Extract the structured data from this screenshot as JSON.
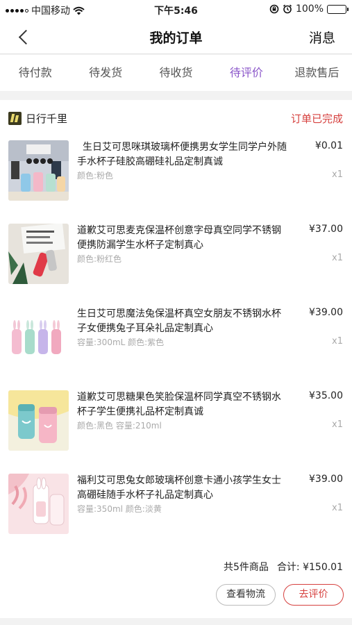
{
  "status_bar": {
    "carrier": "中国移动",
    "time": "下午5:46",
    "battery": "100%"
  },
  "nav": {
    "title": "我的订单",
    "right_label": "消息"
  },
  "tabs": [
    {
      "label": "待付款",
      "active": false
    },
    {
      "label": "待发货",
      "active": false
    },
    {
      "label": "待收货",
      "active": false
    },
    {
      "label": "待评价",
      "active": true
    },
    {
      "label": "退款售后",
      "active": false
    }
  ],
  "order": {
    "shop_name": "日行千里",
    "status": "订单已完成",
    "items": [
      {
        "title": "生日艾可思咪琪玻璃杯便携男女学生同学户外随手水杯子硅胶高硼硅礼品定制真诚",
        "spec": "颜色:粉色",
        "price": "¥0.01",
        "qty": "x1"
      },
      {
        "title": "道歉艾可思麦克保温杯创意字母真空同学不锈钢便携防漏学生水杯子定制真心",
        "spec": "颜色:粉红色",
        "price": "¥37.00",
        "qty": "x1"
      },
      {
        "title": "生日艾可思魔法兔保温杯真空女朋友不锈钢水杯子女便携兔子耳朵礼品定制真心",
        "spec": "容量:300mL 颜色:紫色",
        "price": "¥39.00",
        "qty": "x1"
      },
      {
        "title": "道歉艾可思糖果色笑脸保温杯同学真空不锈钢水杯子学生便携礼品杯定制真诚",
        "spec": "颜色:黑色 容量:210ml",
        "price": "¥35.00",
        "qty": "x1"
      },
      {
        "title": "福利艾可思兔女郎玻璃杯创意卡通小孩学生女士高硼硅随手水杯子礼品定制真心",
        "spec": "容量:350ml 颜色:淡黄",
        "price": "¥39.00",
        "qty": "x1"
      }
    ],
    "summary_count": "共5件商品",
    "summary_total": "合计: ¥150.01",
    "btn_logistics": "查看物流",
    "btn_review": "去评价"
  },
  "colors": {
    "accent_purple": "#8a55c9",
    "status_red": "#d6403e"
  },
  "icons": [
    "signal-icon",
    "wifi-icon",
    "lock-rotation-icon",
    "alarm-icon",
    "battery-icon",
    "back-chevron-icon",
    "shop-logo-icon"
  ]
}
